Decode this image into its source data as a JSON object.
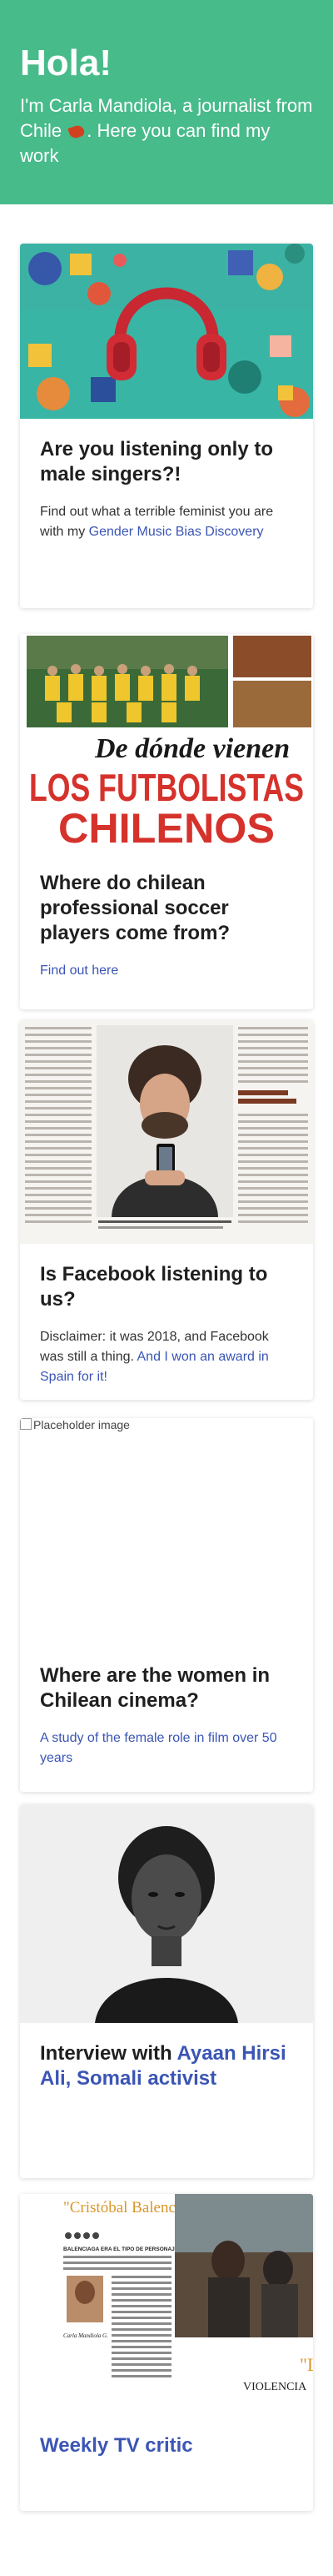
{
  "hero": {
    "title": "Hola!",
    "intro_before": "I'm Carla Mandiola, a journalist from Chile ",
    "intro_after": ". Here you can find my work",
    "bg_color": "#48bb8a"
  },
  "cards": [
    {
      "title": "Are you listening only to male singers?!",
      "text_before": "Find out what a terrible feminist you are with my ",
      "link": "Gender Music Bias Discovery",
      "image_icon": "headphones-icon"
    },
    {
      "image_headline_small": "De dónde vienen",
      "image_headline_big1": "LOS FUTBOLISTAS",
      "image_headline_big2": "CHILENOS",
      "title": "Where do chilean professional soccer players come from?",
      "link": "Find out here"
    },
    {
      "title": "Is Facebook listening to us?",
      "text_before": "Disclaimer: it was 2018, and Facebook was still a thing. ",
      "link": "And I won an award in Spain for it!"
    },
    {
      "image_alt": "Placeholder image",
      "title": "Where are the women in Chilean cinema?",
      "link": "A study of the female role in film over 50 years"
    },
    {
      "title_prefix": "Interview with ",
      "title_highlight": "Ayaan Hirsi Ali, Somali activist"
    },
    {
      "image_title_left": "\"Cristóbal Balenciaga\"",
      "image_subhead": "BALENCIAGA ERA EL TIPO DE PERSONAJE",
      "image_author": "Carla Mandiola G.",
      "image_title_right": "\"Los",
      "image_subtitle_right": "VIOLENCIA",
      "title": "Weekly TV critic"
    }
  ]
}
